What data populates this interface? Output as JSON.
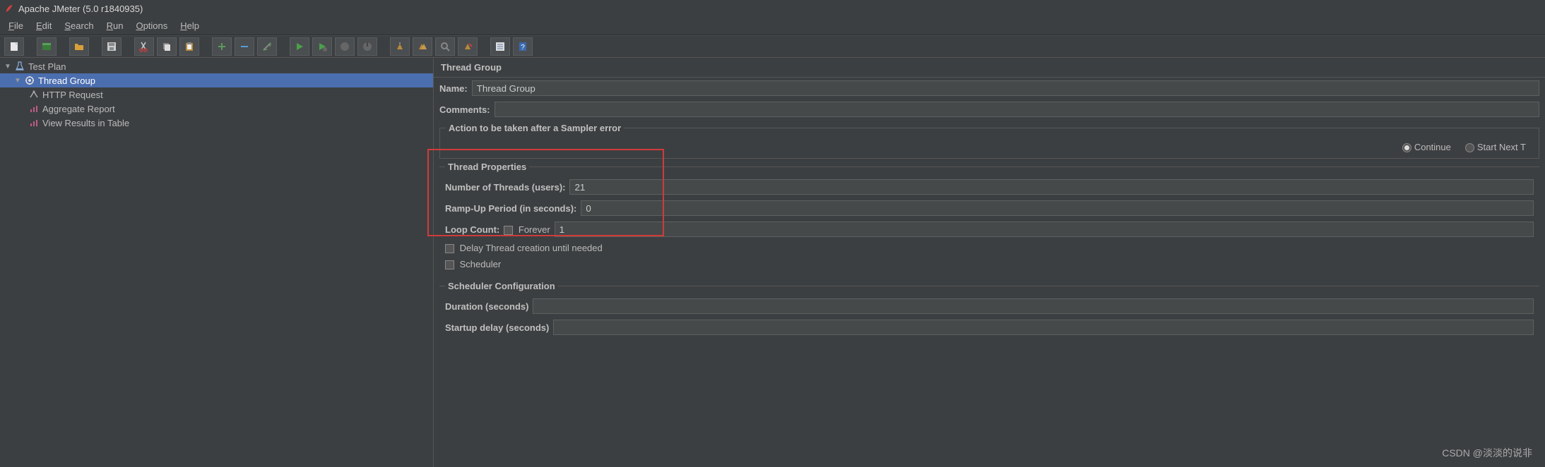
{
  "title": "Apache JMeter (5.0 r1840935)",
  "menu": {
    "file": "File",
    "edit": "Edit",
    "search": "Search",
    "run": "Run",
    "options": "Options",
    "help": "Help"
  },
  "tree": {
    "root": "Test Plan",
    "items": [
      {
        "label": "Thread Group",
        "icon": "gear"
      },
      {
        "label": "HTTP Request",
        "icon": "sampler"
      },
      {
        "label": "Aggregate Report",
        "icon": "report"
      },
      {
        "label": "View Results in Table",
        "icon": "report"
      }
    ]
  },
  "panel": {
    "title": "Thread Group",
    "name_label": "Name:",
    "name_value": "Thread Group",
    "comments_label": "Comments:",
    "action_legend": "Action to be taken after a Sampler error",
    "radios": {
      "continue": "Continue",
      "start_next": "Start Next T"
    },
    "thread_legend": "Thread Properties",
    "num_threads_label": "Number of Threads (users):",
    "num_threads_value": "21",
    "ramp_label": "Ramp-Up Period (in seconds):",
    "ramp_value": "0",
    "loop_label": "Loop Count:",
    "forever_label": "Forever",
    "loop_value": "1",
    "delay_label": "Delay Thread creation until needed",
    "scheduler_label": "Scheduler",
    "sched_conf": "Scheduler Configuration",
    "duration_label": "Duration (seconds)",
    "startup_label": "Startup delay (seconds)"
  },
  "watermark": "CSDN @淡淡的说非"
}
